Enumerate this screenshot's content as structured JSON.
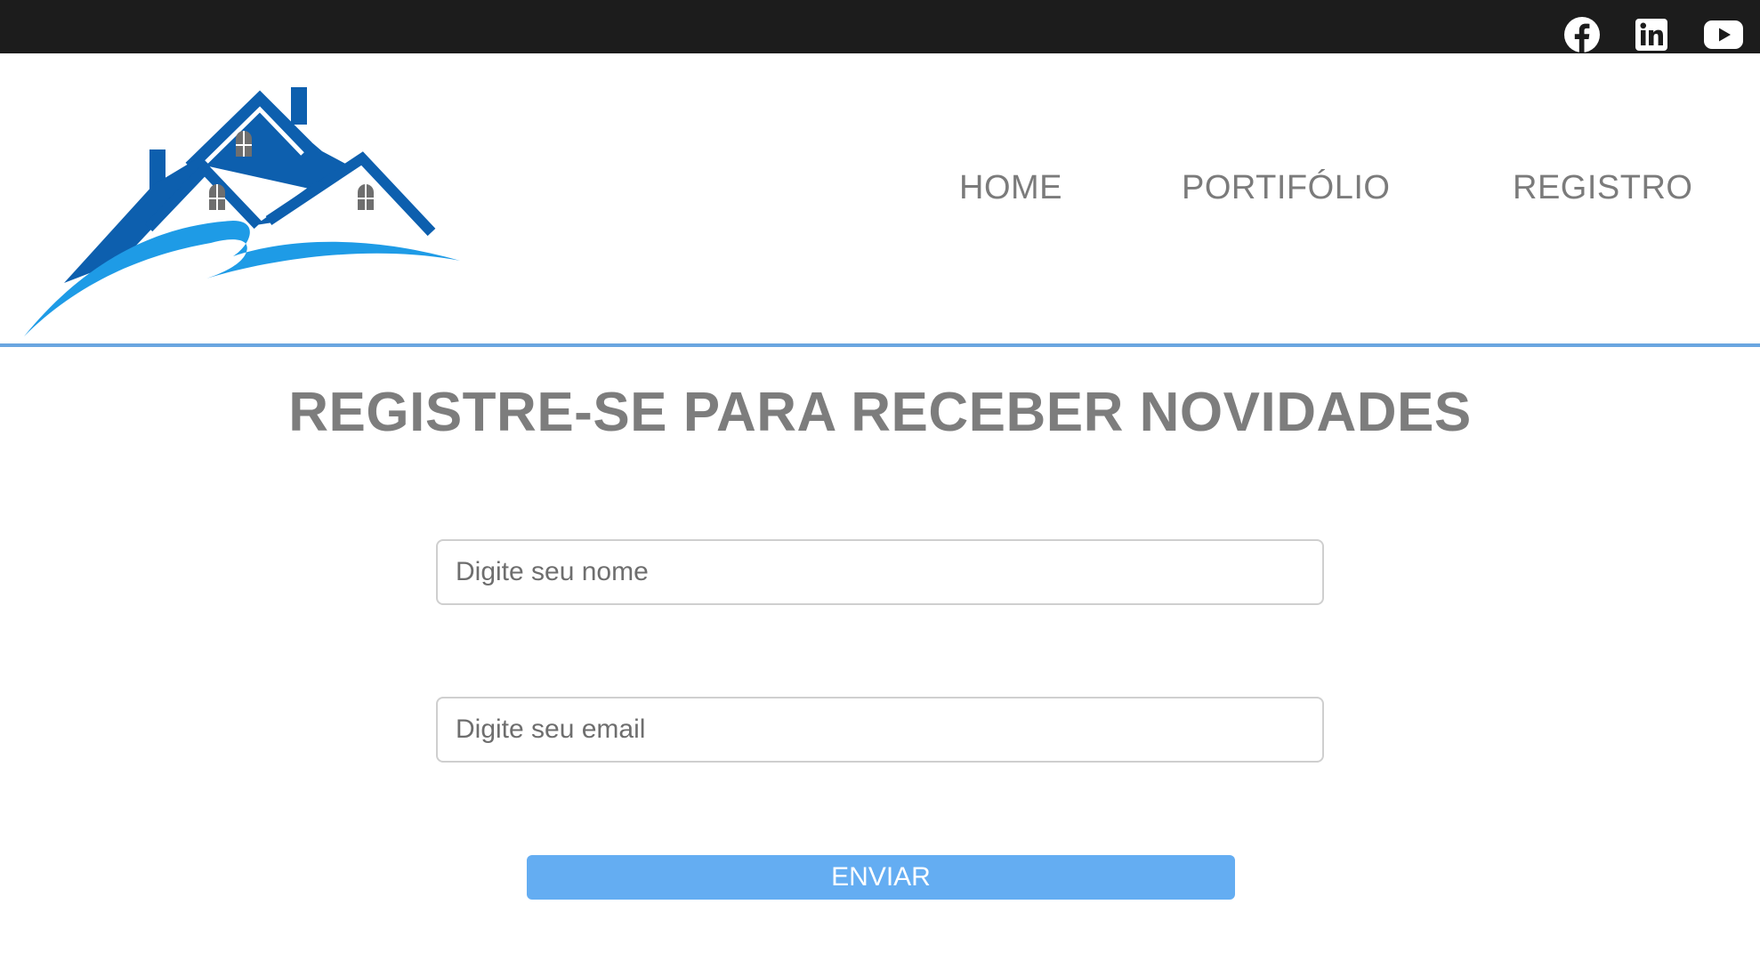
{
  "topbar": {
    "social": [
      {
        "icon": "facebook-icon",
        "label": "Facebook"
      },
      {
        "icon": "linkedin-icon",
        "label": "LinkedIn"
      },
      {
        "icon": "youtube-icon",
        "label": "YouTube"
      }
    ]
  },
  "header": {
    "logo": "house-roof-logo",
    "nav": {
      "home": "HOME",
      "portfolio": "PORTIFÓLIO",
      "registro": "REGISTRO"
    }
  },
  "main": {
    "title": "REGISTRE-SE PARA RECEBER NOVIDADES",
    "form": {
      "name_placeholder": "Digite seu nome",
      "name_value": "",
      "email_placeholder": "Digite seu email",
      "email_value": "",
      "submit_label": "ENVIAR"
    }
  },
  "colors": {
    "topbar": "#1c1c1c",
    "header_border": "#6aa6e0",
    "button": "#64adf2",
    "logo_dark_blue": "#0d5fae",
    "logo_light_blue": "#1e9be6",
    "text_gray": "#7b7b7b"
  }
}
